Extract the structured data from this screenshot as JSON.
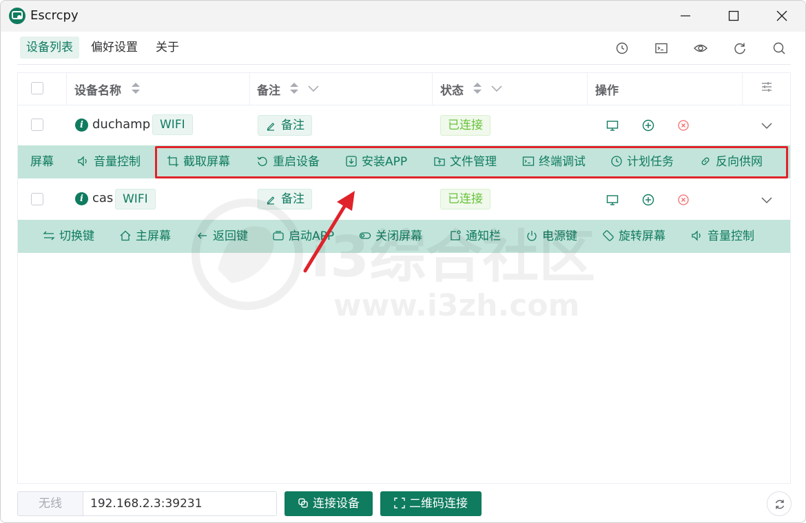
{
  "app": {
    "title": "Escrcpy"
  },
  "nav": {
    "items": [
      "设备列表",
      "偏好设置",
      "关于"
    ],
    "active": "设备列表"
  },
  "table": {
    "headers": {
      "name": "设备名称",
      "remark": "备注",
      "status": "状态",
      "actions": "操作"
    },
    "devices": [
      {
        "name": "duchamp",
        "conn": "WIFI",
        "remark_btn": "备注",
        "status": "已连接"
      },
      {
        "name": "cas",
        "conn": "WIFI",
        "remark_btn": "备注",
        "status": "已连接"
      }
    ]
  },
  "bar1": {
    "items": [
      "屏幕",
      "音量控制",
      "截取屏幕",
      "重启设备",
      "安装APP",
      "文件管理",
      "终端调试",
      "计划任务",
      "反向供网"
    ]
  },
  "bar2": {
    "items": [
      "切换键",
      "主屏幕",
      "返回键",
      "启动APP",
      "关闭屏幕",
      "通知栏",
      "电源键",
      "旋转屏幕",
      "音量控制"
    ]
  },
  "watermark": {
    "text": "i3综合社区",
    "url": "www.i3zh.com"
  },
  "footer": {
    "label": "无线",
    "address": "192.168.2.3:39231",
    "connect_btn": "连接设备",
    "qr_btn": "二维码连接"
  },
  "colors": {
    "accent": "#0f7b5f",
    "bar_bg": "#c3e4da",
    "success": "#67c23a",
    "danger": "#f56c6c",
    "highlight": "#e0222a"
  }
}
